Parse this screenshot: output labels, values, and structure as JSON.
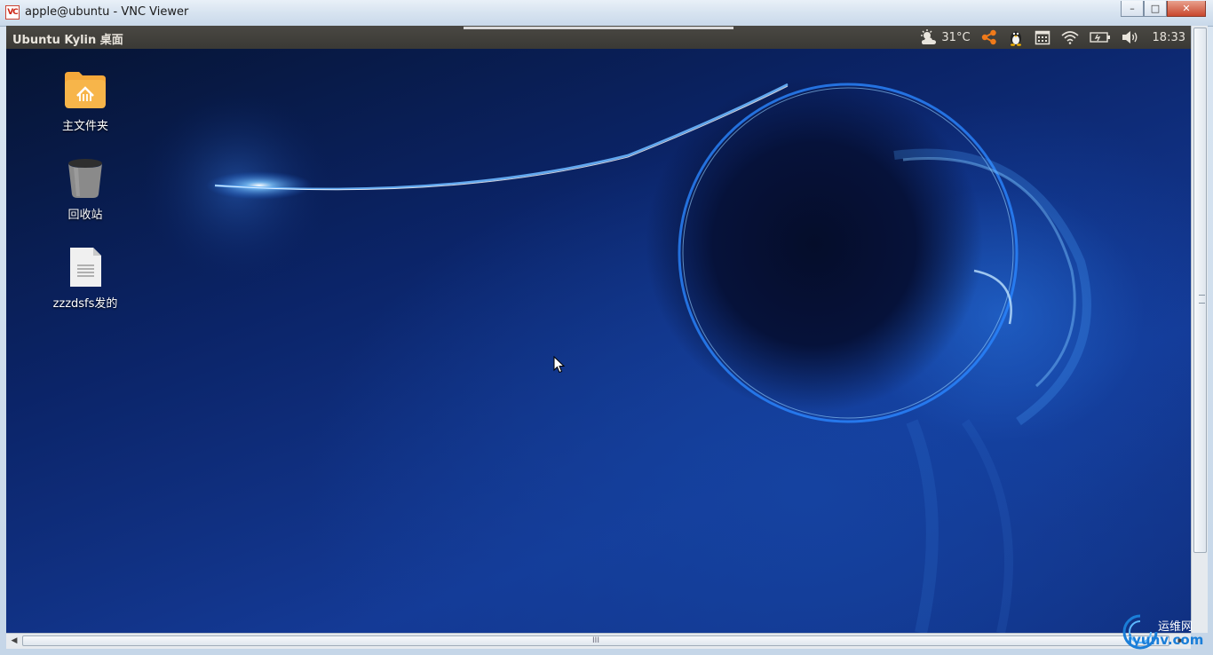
{
  "window": {
    "title": "apple@ubuntu - VNC Viewer",
    "app_icon_text": "VC",
    "minimize_glyph": "–",
    "maximize_glyph": "□",
    "close_glyph": "✕"
  },
  "panel": {
    "title": "Ubuntu Kylin 桌面",
    "indicators": [
      {
        "icon": "weather-icon",
        "text": "31°C"
      },
      {
        "icon": "share-icon",
        "text": ""
      },
      {
        "icon": "penguin-icon",
        "text": ""
      },
      {
        "icon": "calendar-icon",
        "text": ""
      },
      {
        "icon": "wifi-icon",
        "text": ""
      },
      {
        "icon": "battery-icon",
        "text": ""
      },
      {
        "icon": "volume-icon",
        "text": ""
      },
      {
        "icon": "clock",
        "text": "18:33"
      }
    ],
    "clock": "18:33",
    "weather": "31°C"
  },
  "desktop": {
    "icons": [
      {
        "name": "home-folder",
        "label": "主文件夹",
        "icon": "home-folder-icon"
      },
      {
        "name": "trash",
        "label": "回收站",
        "icon": "trash-icon"
      },
      {
        "name": "document",
        "label": "zzzdsfs发的",
        "icon": "document-icon"
      }
    ]
  },
  "scrollbar": {
    "h_grip": "III"
  },
  "watermark": {
    "top": "运维网",
    "bottom": "iyunv.com"
  },
  "colors": {
    "panel_bg": "#3c3b37",
    "wallpaper": "#0f2d7c",
    "glow": "#3aa0ff",
    "folder": "#f5a83a"
  }
}
